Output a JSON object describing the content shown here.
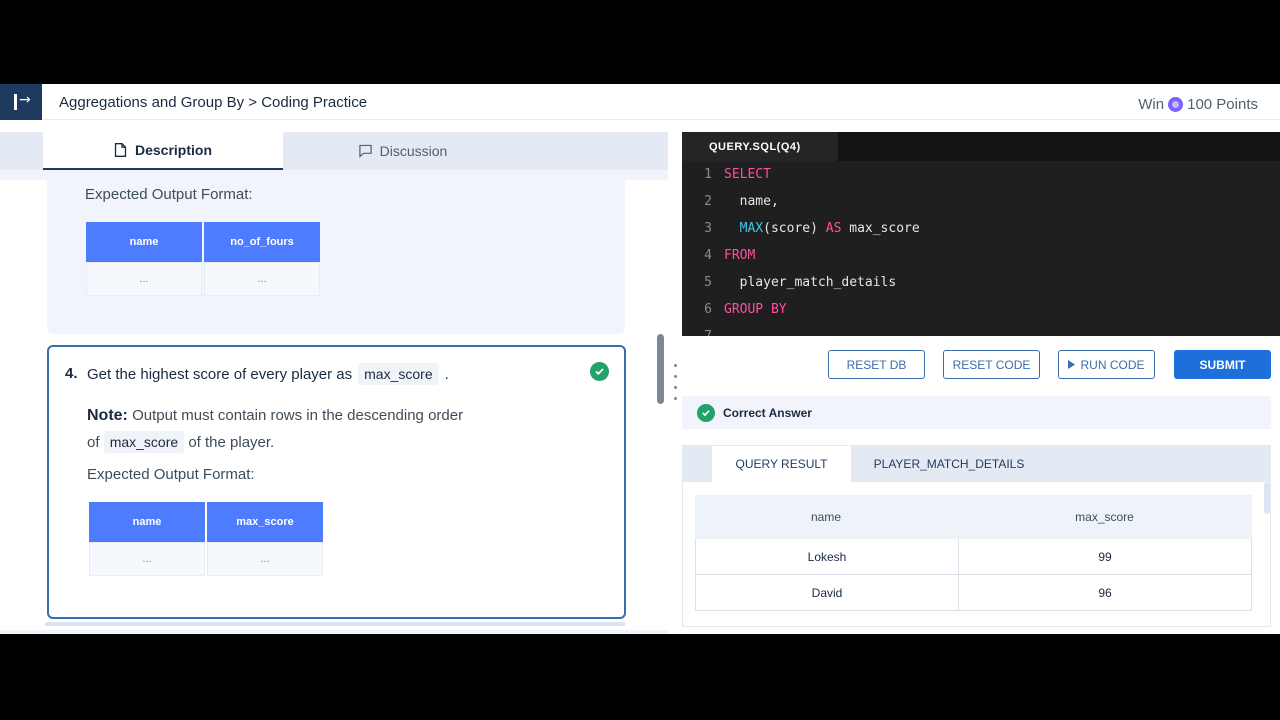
{
  "header": {
    "breadcrumb": "Aggregations and Group By > Coding Practice",
    "win_prefix": "Win",
    "win_points": "100 Points"
  },
  "tabs": {
    "description": "Description",
    "discussion": "Discussion"
  },
  "prev_question": {
    "expected_label": "Expected Output Format:",
    "columns": [
      "name",
      "no_of_fours"
    ],
    "cells": [
      "...",
      "..."
    ]
  },
  "question4": {
    "number": "4.",
    "text": "Get the highest score of every player as",
    "code": "max_score",
    "period": ".",
    "note_label": "Note:",
    "note_text": "Output must contain rows in the descending order",
    "note_of": "of",
    "note_code": "max_score",
    "note_end": "of the player.",
    "expected_label": "Expected Output Format:",
    "columns": [
      "name",
      "max_score"
    ],
    "cells": [
      "...",
      "..."
    ]
  },
  "editor": {
    "tab_label": "QUERY.SQL(Q4)",
    "lines": [
      {
        "n": "1",
        "code": "SELECT"
      },
      {
        "n": "2",
        "code": "  name,"
      },
      {
        "n": "3",
        "code": "  MAX(score) AS max_score"
      },
      {
        "n": "4",
        "code": "FROM"
      },
      {
        "n": "5",
        "code": "  player_match_details"
      },
      {
        "n": "6",
        "code": "GROUP BY"
      },
      {
        "n": "7",
        "code": ""
      }
    ]
  },
  "buttons": {
    "reset_db": "RESET DB",
    "reset_code": "RESET CODE",
    "run_code": "RUN CODE",
    "submit": "SUBMIT"
  },
  "status": {
    "correct": "Correct Answer"
  },
  "result": {
    "tabs": [
      "QUERY RESULT",
      "PLAYER_MATCH_DETAILS"
    ],
    "columns": [
      "name",
      "max_score"
    ],
    "rows": [
      [
        "Lokesh",
        "99"
      ],
      [
        "David",
        "96"
      ]
    ]
  },
  "colors": {
    "accent": "#1e6fd9",
    "header_blue": "#4d7cff",
    "success": "#21a36b",
    "editor_bg": "#1f1f1f"
  }
}
